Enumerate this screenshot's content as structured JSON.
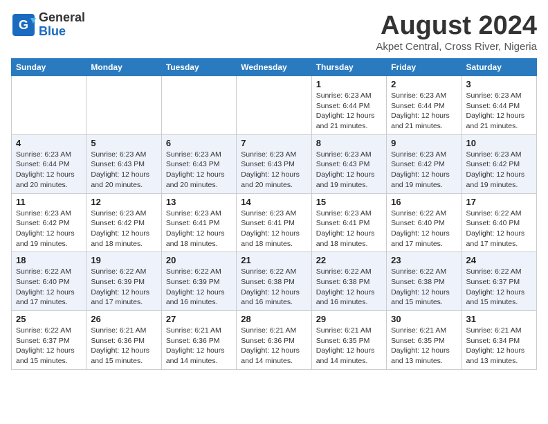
{
  "header": {
    "logo_line1": "General",
    "logo_line2": "Blue",
    "month_year": "August 2024",
    "location": "Akpet Central, Cross River, Nigeria"
  },
  "weekdays": [
    "Sunday",
    "Monday",
    "Tuesday",
    "Wednesday",
    "Thursday",
    "Friday",
    "Saturday"
  ],
  "weeks": [
    [
      {
        "day": "",
        "info": ""
      },
      {
        "day": "",
        "info": ""
      },
      {
        "day": "",
        "info": ""
      },
      {
        "day": "",
        "info": ""
      },
      {
        "day": "1",
        "info": "Sunrise: 6:23 AM\nSunset: 6:44 PM\nDaylight: 12 hours\nand 21 minutes."
      },
      {
        "day": "2",
        "info": "Sunrise: 6:23 AM\nSunset: 6:44 PM\nDaylight: 12 hours\nand 21 minutes."
      },
      {
        "day": "3",
        "info": "Sunrise: 6:23 AM\nSunset: 6:44 PM\nDaylight: 12 hours\nand 21 minutes."
      }
    ],
    [
      {
        "day": "4",
        "info": "Sunrise: 6:23 AM\nSunset: 6:44 PM\nDaylight: 12 hours\nand 20 minutes."
      },
      {
        "day": "5",
        "info": "Sunrise: 6:23 AM\nSunset: 6:43 PM\nDaylight: 12 hours\nand 20 minutes."
      },
      {
        "day": "6",
        "info": "Sunrise: 6:23 AM\nSunset: 6:43 PM\nDaylight: 12 hours\nand 20 minutes."
      },
      {
        "day": "7",
        "info": "Sunrise: 6:23 AM\nSunset: 6:43 PM\nDaylight: 12 hours\nand 20 minutes."
      },
      {
        "day": "8",
        "info": "Sunrise: 6:23 AM\nSunset: 6:43 PM\nDaylight: 12 hours\nand 19 minutes."
      },
      {
        "day": "9",
        "info": "Sunrise: 6:23 AM\nSunset: 6:42 PM\nDaylight: 12 hours\nand 19 minutes."
      },
      {
        "day": "10",
        "info": "Sunrise: 6:23 AM\nSunset: 6:42 PM\nDaylight: 12 hours\nand 19 minutes."
      }
    ],
    [
      {
        "day": "11",
        "info": "Sunrise: 6:23 AM\nSunset: 6:42 PM\nDaylight: 12 hours\nand 19 minutes."
      },
      {
        "day": "12",
        "info": "Sunrise: 6:23 AM\nSunset: 6:42 PM\nDaylight: 12 hours\nand 18 minutes."
      },
      {
        "day": "13",
        "info": "Sunrise: 6:23 AM\nSunset: 6:41 PM\nDaylight: 12 hours\nand 18 minutes."
      },
      {
        "day": "14",
        "info": "Sunrise: 6:23 AM\nSunset: 6:41 PM\nDaylight: 12 hours\nand 18 minutes."
      },
      {
        "day": "15",
        "info": "Sunrise: 6:23 AM\nSunset: 6:41 PM\nDaylight: 12 hours\nand 18 minutes."
      },
      {
        "day": "16",
        "info": "Sunrise: 6:22 AM\nSunset: 6:40 PM\nDaylight: 12 hours\nand 17 minutes."
      },
      {
        "day": "17",
        "info": "Sunrise: 6:22 AM\nSunset: 6:40 PM\nDaylight: 12 hours\nand 17 minutes."
      }
    ],
    [
      {
        "day": "18",
        "info": "Sunrise: 6:22 AM\nSunset: 6:40 PM\nDaylight: 12 hours\nand 17 minutes."
      },
      {
        "day": "19",
        "info": "Sunrise: 6:22 AM\nSunset: 6:39 PM\nDaylight: 12 hours\nand 17 minutes."
      },
      {
        "day": "20",
        "info": "Sunrise: 6:22 AM\nSunset: 6:39 PM\nDaylight: 12 hours\nand 16 minutes."
      },
      {
        "day": "21",
        "info": "Sunrise: 6:22 AM\nSunset: 6:38 PM\nDaylight: 12 hours\nand 16 minutes."
      },
      {
        "day": "22",
        "info": "Sunrise: 6:22 AM\nSunset: 6:38 PM\nDaylight: 12 hours\nand 16 minutes."
      },
      {
        "day": "23",
        "info": "Sunrise: 6:22 AM\nSunset: 6:38 PM\nDaylight: 12 hours\nand 15 minutes."
      },
      {
        "day": "24",
        "info": "Sunrise: 6:22 AM\nSunset: 6:37 PM\nDaylight: 12 hours\nand 15 minutes."
      }
    ],
    [
      {
        "day": "25",
        "info": "Sunrise: 6:22 AM\nSunset: 6:37 PM\nDaylight: 12 hours\nand 15 minutes."
      },
      {
        "day": "26",
        "info": "Sunrise: 6:21 AM\nSunset: 6:36 PM\nDaylight: 12 hours\nand 15 minutes."
      },
      {
        "day": "27",
        "info": "Sunrise: 6:21 AM\nSunset: 6:36 PM\nDaylight: 12 hours\nand 14 minutes."
      },
      {
        "day": "28",
        "info": "Sunrise: 6:21 AM\nSunset: 6:36 PM\nDaylight: 12 hours\nand 14 minutes."
      },
      {
        "day": "29",
        "info": "Sunrise: 6:21 AM\nSunset: 6:35 PM\nDaylight: 12 hours\nand 14 minutes."
      },
      {
        "day": "30",
        "info": "Sunrise: 6:21 AM\nSunset: 6:35 PM\nDaylight: 12 hours\nand 13 minutes."
      },
      {
        "day": "31",
        "info": "Sunrise: 6:21 AM\nSunset: 6:34 PM\nDaylight: 12 hours\nand 13 minutes."
      }
    ]
  ]
}
